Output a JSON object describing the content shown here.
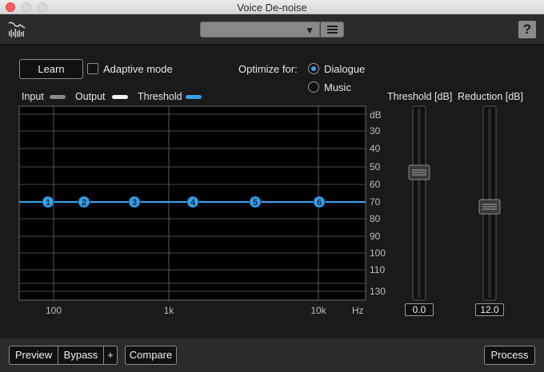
{
  "window": {
    "title": "Voice De-noise"
  },
  "toolbar": {
    "preset_value": "",
    "help_label": "?"
  },
  "controls": {
    "learn_label": "Learn",
    "adaptive_label": "Adaptive mode",
    "optimize_label": "Optimize for:",
    "options": [
      "Dialogue",
      "Music"
    ],
    "selected_option": "Dialogue"
  },
  "legend": [
    {
      "label": "Input",
      "color": "#8a8a8a"
    },
    {
      "label": "Output",
      "color": "#f2f2f2"
    },
    {
      "label": "Threshold",
      "color": "#3aa0e8"
    }
  ],
  "graph": {
    "y_unit": "dB",
    "y_ticks": [
      "30",
      "40",
      "50",
      "60",
      "70",
      "80",
      "90",
      "100",
      "110",
      "130"
    ],
    "x_ticks": [
      "100",
      "1k",
      "10k"
    ],
    "x_unit": "Hz",
    "threshold_level_db": 70,
    "nodes": [
      "1",
      "2",
      "3",
      "4",
      "5",
      "6"
    ],
    "accent": "#3aa0e8"
  },
  "sliders": [
    {
      "label": "Threshold [dB]",
      "value": "0.0"
    },
    {
      "label": "Reduction [dB]",
      "value": "12.0"
    }
  ],
  "footer": {
    "preview_label": "Preview",
    "bypass_label": "Bypass",
    "plus_label": "+",
    "compare_label": "Compare",
    "process_label": "Process"
  }
}
